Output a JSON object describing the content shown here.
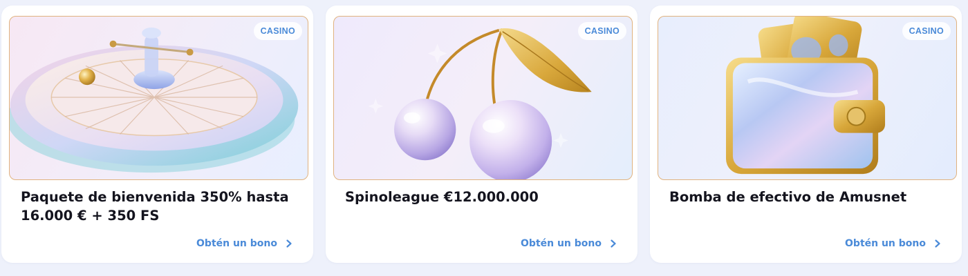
{
  "colors": {
    "page_background": "#eef1fb",
    "card_background": "#ffffff",
    "accent": "#4a8ad8",
    "title_text": "#14141e",
    "image_border": "#e0b27e"
  },
  "cards": [
    {
      "badge": "CASINO",
      "title": "Paquete de bienvenida 350% hasta 16.000 € + 350 FS",
      "cta_label": "Obtén un bono",
      "cta_icon": "chevron-right-icon",
      "image": "roulette-wheel-illustration"
    },
    {
      "badge": "CASINO",
      "title": "Spinoleague €12.000.000",
      "cta_label": "Obtén un bono",
      "cta_icon": "chevron-right-icon",
      "image": "cherries-illustration"
    },
    {
      "badge": "CASINO",
      "title": "Bomba de efectivo de Amusnet",
      "cta_label": "Obtén un bono",
      "cta_icon": "chevron-right-icon",
      "image": "wallet-illustration"
    }
  ]
}
